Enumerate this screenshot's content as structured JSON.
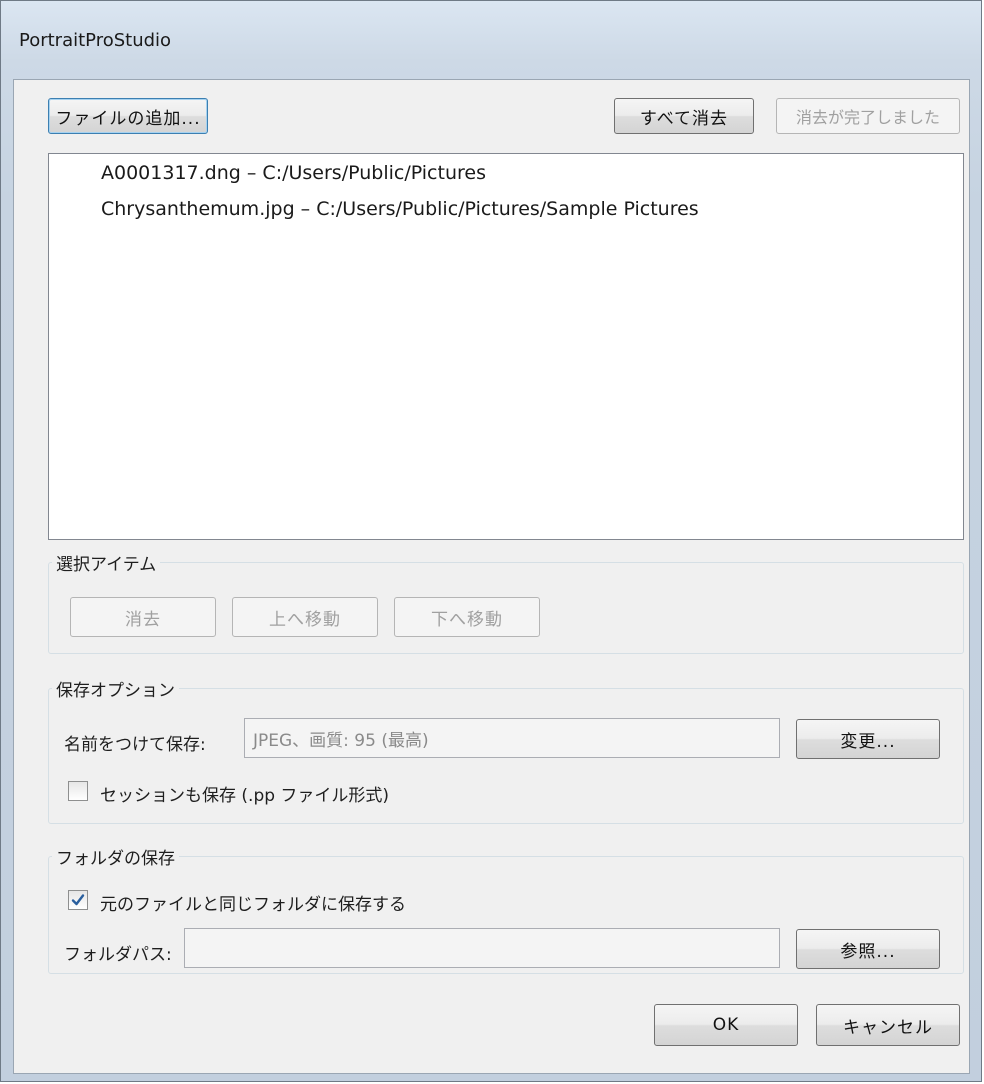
{
  "window": {
    "title": "PortraitProStudio"
  },
  "toolbar": {
    "add_files": "ファイルの追加...",
    "clear_all": "すべて消去",
    "clear_completed": "消去が完了しました"
  },
  "file_list": [
    {
      "name": "A0001317.dng",
      "sep": " – ",
      "path": "C:/Users/Public/Pictures"
    },
    {
      "name": "Chrysanthemum.jpg",
      "sep": " – ",
      "path": "C:/Users/Public/Pictures/Sample Pictures"
    }
  ],
  "selected_items": {
    "legend": "選択アイテム",
    "delete": "消去",
    "move_up": "上へ移動",
    "move_down": "下へ移動"
  },
  "save_options": {
    "legend": "保存オプション",
    "save_as_label": "名前をつけて保存:",
    "save_as_value": "JPEG、画質: 95 (最高)",
    "change_button": "変更...",
    "save_session_label": "セッションも保存 (.pp ファイル形式)",
    "save_session_checked": false
  },
  "save_folder": {
    "legend": "フォルダの保存",
    "same_folder_label": "元のファイルと同じフォルダに保存する",
    "same_folder_checked": true,
    "folder_path_label": "フォルダパス:",
    "folder_path_value": "",
    "browse_button": "参照..."
  },
  "footer": {
    "ok": "OK",
    "cancel": "キャンセル"
  },
  "colors": {
    "check_mark": "#2a5f9e",
    "focus_border": "#3c7fb1"
  }
}
